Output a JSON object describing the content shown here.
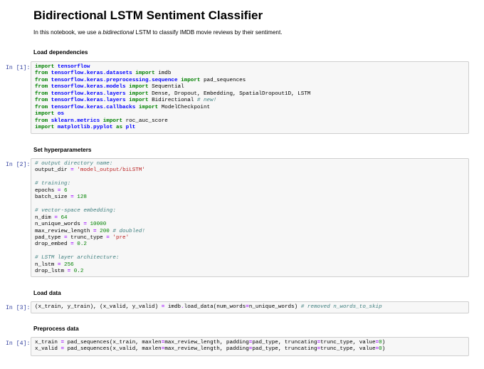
{
  "notebook": {
    "title": "Bidirectional LSTM Sentiment Classifier",
    "intro_prefix": "In this notebook, we use a ",
    "intro_emph": "bidirectional",
    "intro_suffix": " LSTM to classify IMDB movie reviews by their sentiment."
  },
  "cells": [
    {
      "heading": "Load dependencies",
      "prompt": "In [1]:",
      "code": [
        [
          [
            "kw",
            "import"
          ],
          [
            "t",
            " "
          ],
          [
            "mod",
            "tensorflow"
          ]
        ],
        [
          [
            "kw",
            "from"
          ],
          [
            "t",
            " "
          ],
          [
            "mod",
            "tensorflow.keras.datasets"
          ],
          [
            "t",
            " "
          ],
          [
            "kw",
            "import"
          ],
          [
            "t",
            " imdb"
          ]
        ],
        [
          [
            "kw",
            "from"
          ],
          [
            "t",
            " "
          ],
          [
            "mod",
            "tensorflow.keras.preprocessing.sequence"
          ],
          [
            "t",
            " "
          ],
          [
            "kw",
            "import"
          ],
          [
            "t",
            " pad_sequences"
          ]
        ],
        [
          [
            "kw",
            "from"
          ],
          [
            "t",
            " "
          ],
          [
            "mod",
            "tensorflow.keras.models"
          ],
          [
            "t",
            " "
          ],
          [
            "kw",
            "import"
          ],
          [
            "t",
            " Sequential"
          ]
        ],
        [
          [
            "kw",
            "from"
          ],
          [
            "t",
            " "
          ],
          [
            "mod",
            "tensorflow.keras.layers"
          ],
          [
            "t",
            " "
          ],
          [
            "kw",
            "import"
          ],
          [
            "t",
            " Dense, Dropout, Embedding, SpatialDropout1D, LSTM"
          ]
        ],
        [
          [
            "kw",
            "from"
          ],
          [
            "t",
            " "
          ],
          [
            "mod",
            "tensorflow.keras.layers"
          ],
          [
            "t",
            " "
          ],
          [
            "kw",
            "import"
          ],
          [
            "t",
            " Bidirectional "
          ],
          [
            "cm",
            "# new!"
          ]
        ],
        [
          [
            "kw",
            "from"
          ],
          [
            "t",
            " "
          ],
          [
            "mod",
            "tensorflow.keras.callbacks"
          ],
          [
            "t",
            " "
          ],
          [
            "kw",
            "import"
          ],
          [
            "t",
            " ModelCheckpoint"
          ]
        ],
        [
          [
            "kw",
            "import"
          ],
          [
            "t",
            " "
          ],
          [
            "mod",
            "os"
          ]
        ],
        [
          [
            "kw",
            "from"
          ],
          [
            "t",
            " "
          ],
          [
            "mod",
            "sklearn.metrics"
          ],
          [
            "t",
            " "
          ],
          [
            "kw",
            "import"
          ],
          [
            "t",
            " roc_auc_score"
          ]
        ],
        [
          [
            "kw",
            "import"
          ],
          [
            "t",
            " "
          ],
          [
            "mod",
            "matplotlib.pyplot"
          ],
          [
            "t",
            " "
          ],
          [
            "kw",
            "as"
          ],
          [
            "t",
            " "
          ],
          [
            "mod",
            "plt"
          ]
        ]
      ]
    },
    {
      "heading": "Set hyperparameters",
      "prompt": "In [2]:",
      "code": [
        [
          [
            "cm",
            "# output directory name:"
          ]
        ],
        [
          [
            "t",
            "output_dir "
          ],
          [
            "op",
            "="
          ],
          [
            "t",
            " "
          ],
          [
            "st",
            "'model_output/biLSTM'"
          ]
        ],
        [],
        [
          [
            "cm",
            "# training:"
          ]
        ],
        [
          [
            "t",
            "epochs "
          ],
          [
            "op",
            "="
          ],
          [
            "t",
            " "
          ],
          [
            "nm",
            "6"
          ]
        ],
        [
          [
            "t",
            "batch_size "
          ],
          [
            "op",
            "="
          ],
          [
            "t",
            " "
          ],
          [
            "nm",
            "128"
          ]
        ],
        [],
        [
          [
            "cm",
            "# vector-space embedding:"
          ]
        ],
        [
          [
            "t",
            "n_dim "
          ],
          [
            "op",
            "="
          ],
          [
            "t",
            " "
          ],
          [
            "nm",
            "64"
          ]
        ],
        [
          [
            "t",
            "n_unique_words "
          ],
          [
            "op",
            "="
          ],
          [
            "t",
            " "
          ],
          [
            "nm",
            "10000"
          ]
        ],
        [
          [
            "t",
            "max_review_length "
          ],
          [
            "op",
            "="
          ],
          [
            "t",
            " "
          ],
          [
            "nm",
            "200"
          ],
          [
            "t",
            " "
          ],
          [
            "cm",
            "# doubled!"
          ]
        ],
        [
          [
            "t",
            "pad_type "
          ],
          [
            "op",
            "="
          ],
          [
            "t",
            " trunc_type "
          ],
          [
            "op",
            "="
          ],
          [
            "t",
            " "
          ],
          [
            "st",
            "'pre'"
          ]
        ],
        [
          [
            "t",
            "drop_embed "
          ],
          [
            "op",
            "="
          ],
          [
            "t",
            " "
          ],
          [
            "nm",
            "0.2"
          ]
        ],
        [],
        [
          [
            "cm",
            "# LSTM layer architecture:"
          ]
        ],
        [
          [
            "t",
            "n_lstm "
          ],
          [
            "op",
            "="
          ],
          [
            "t",
            " "
          ],
          [
            "nm",
            "256"
          ]
        ],
        [
          [
            "t",
            "drop_lstm "
          ],
          [
            "op",
            "="
          ],
          [
            "t",
            " "
          ],
          [
            "nm",
            "0.2"
          ]
        ]
      ]
    },
    {
      "heading": "Load data",
      "prompt": "In [3]:",
      "code": [
        [
          [
            "t",
            "(x_train, y_train), (x_valid, y_valid) "
          ],
          [
            "op",
            "="
          ],
          [
            "t",
            " imdb"
          ],
          [
            "op",
            "."
          ],
          [
            "t",
            "load_data(num_words"
          ],
          [
            "op",
            "="
          ],
          [
            "t",
            "n_unique_words) "
          ],
          [
            "cm",
            "# removed n_words_to_skip"
          ]
        ]
      ]
    },
    {
      "heading": "Preprocess data",
      "prompt": "In [4]:",
      "code": [
        [
          [
            "t",
            "x_train "
          ],
          [
            "op",
            "="
          ],
          [
            "t",
            " pad_sequences(x_train, maxlen"
          ],
          [
            "op",
            "="
          ],
          [
            "t",
            "max_review_length, padding"
          ],
          [
            "op",
            "="
          ],
          [
            "t",
            "pad_type, truncating"
          ],
          [
            "op",
            "="
          ],
          [
            "t",
            "trunc_type, value"
          ],
          [
            "op",
            "="
          ],
          [
            "nm",
            "0"
          ],
          [
            "t",
            ")"
          ]
        ],
        [
          [
            "t",
            "x_valid "
          ],
          [
            "op",
            "="
          ],
          [
            "t",
            " pad_sequences(x_valid, maxlen"
          ],
          [
            "op",
            "="
          ],
          [
            "t",
            "max_review_length, padding"
          ],
          [
            "op",
            "="
          ],
          [
            "t",
            "pad_type, truncating"
          ],
          [
            "op",
            "="
          ],
          [
            "t",
            "trunc_type, value"
          ],
          [
            "op",
            "="
          ],
          [
            "nm",
            "0"
          ],
          [
            "t",
            ")"
          ]
        ]
      ]
    }
  ]
}
